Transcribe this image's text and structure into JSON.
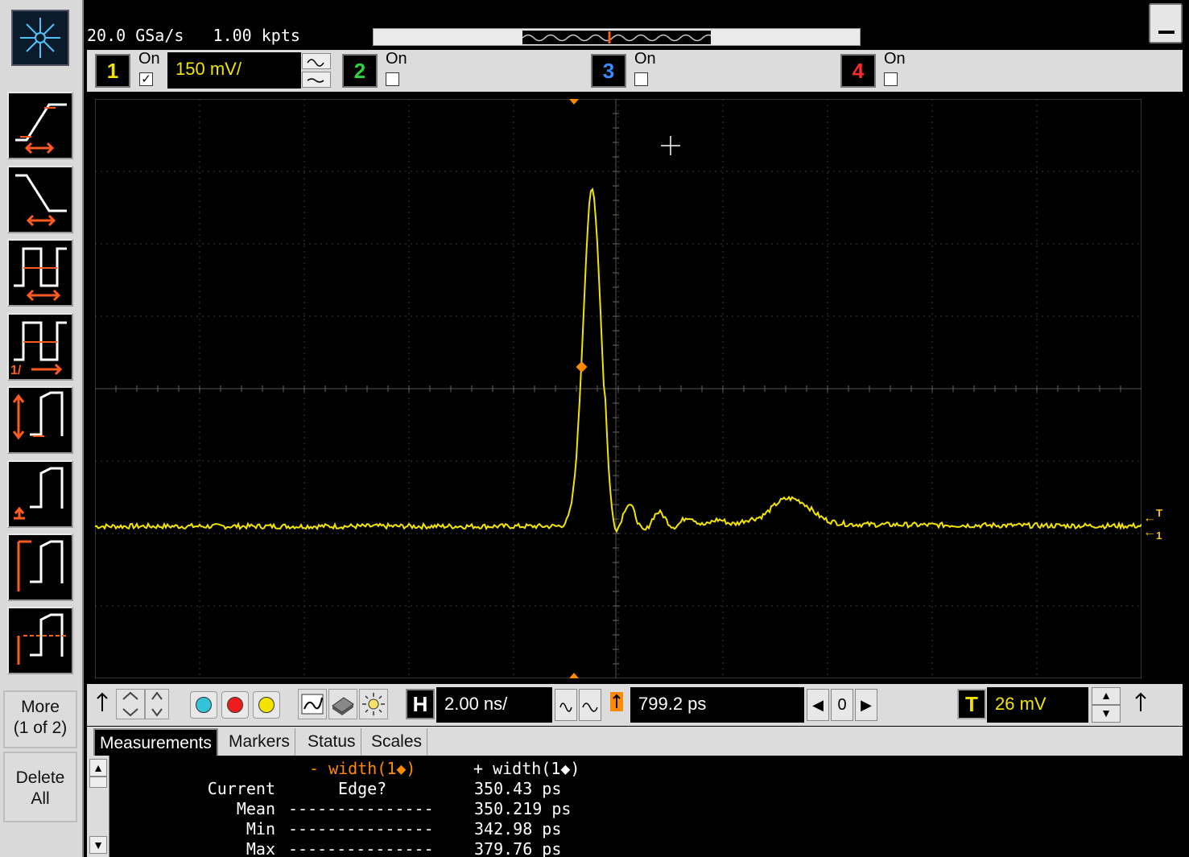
{
  "topbar": {
    "sample_rate": "20.0 GSa/s",
    "record_length": "1.00 kpts"
  },
  "channels": [
    {
      "number": "1",
      "on_label": "On",
      "checked": true,
      "color": "#f2e400",
      "scale": "150 mV/"
    },
    {
      "number": "2",
      "on_label": "On",
      "checked": false,
      "color": "#2bd63a"
    },
    {
      "number": "3",
      "on_label": "On",
      "checked": false,
      "color": "#3a8bff"
    },
    {
      "number": "4",
      "on_label": "On",
      "checked": false,
      "color": "#ff2a2a"
    }
  ],
  "sidebar": {
    "more_label": "More",
    "more_page": "(1 of 2)",
    "delete_line1": "Delete",
    "delete_line2": "All",
    "tools": [
      "rise-time-icon",
      "fall-time-icon",
      "period-icon",
      "frequency-icon",
      "vpp-icon",
      "vmin-icon",
      "vmax-icon",
      "vavg-icon"
    ]
  },
  "controls": {
    "horizontal_label": "H",
    "time_scale": "2.00 ns/",
    "delay": "799.2 ps",
    "delay_step": "0",
    "trigger_label": "T",
    "trigger_level": "26 mV"
  },
  "tabs": [
    "Measurements",
    "Markers",
    "Status",
    "Scales"
  ],
  "active_tab": "Measurements",
  "measurements": {
    "col1_header": "- width(1◆)",
    "col2_header": "+ width(1◆)",
    "rows": [
      {
        "label": "Current",
        "col1": "Edge?",
        "col2": "350.43 ps"
      },
      {
        "label": "Mean",
        "col1": "---------------",
        "col2": "350.219 ps"
      },
      {
        "label": "Min",
        "col1": "---------------",
        "col2": "342.98 ps"
      },
      {
        "label": "Max",
        "col1": "---------------",
        "col2": "379.76 ps"
      }
    ]
  },
  "waveform": {
    "color": "#f2e400",
    "baseline_divisions": -1.9,
    "peak_divisions": 2.75,
    "peak_time_divisions": -0.25
  }
}
